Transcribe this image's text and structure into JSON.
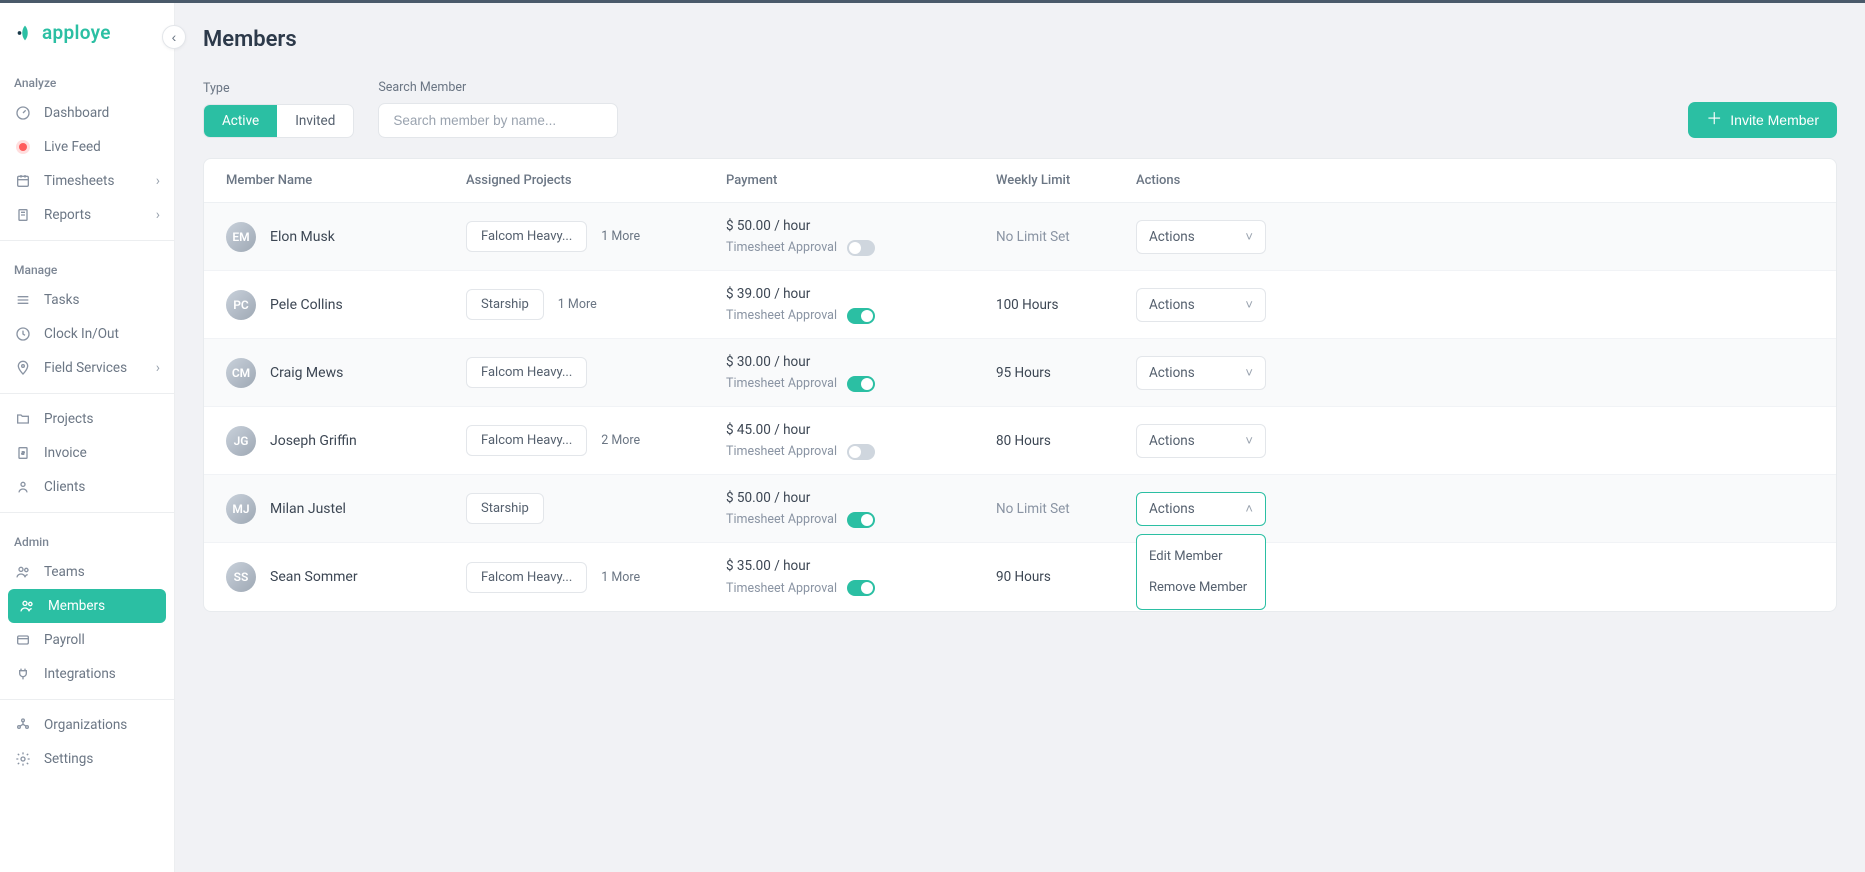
{
  "brand": {
    "name": "apploye"
  },
  "sidebar": {
    "sections": [
      {
        "title": "Analyze",
        "items": [
          {
            "id": "dashboard",
            "label": "Dashboard",
            "icon": "gauge-icon"
          },
          {
            "id": "live-feed",
            "label": "Live Feed",
            "icon": "live-dot-icon"
          },
          {
            "id": "timesheets",
            "label": "Timesheets",
            "icon": "calendar-icon",
            "chevron": true
          },
          {
            "id": "reports",
            "label": "Reports",
            "icon": "doc-icon",
            "chevron": true
          }
        ]
      },
      {
        "title": "Manage",
        "items": [
          {
            "id": "tasks",
            "label": "Tasks",
            "icon": "list-icon"
          },
          {
            "id": "clock",
            "label": "Clock In/Out",
            "icon": "clock-icon"
          },
          {
            "id": "field-services",
            "label": "Field Services",
            "icon": "pin-icon",
            "chevron": true
          },
          {
            "id": "projects",
            "label": "Projects",
            "icon": "folder-icon"
          },
          {
            "id": "invoice",
            "label": "Invoice",
            "icon": "dollar-file-icon"
          },
          {
            "id": "clients",
            "label": "Clients",
            "icon": "person-icon"
          }
        ]
      },
      {
        "title": "Admin",
        "items": [
          {
            "id": "teams",
            "label": "Teams",
            "icon": "people-icon"
          },
          {
            "id": "members",
            "label": "Members",
            "icon": "people-icon",
            "active": true
          },
          {
            "id": "payroll",
            "label": "Payroll",
            "icon": "card-icon"
          },
          {
            "id": "integrations",
            "label": "Integrations",
            "icon": "plug-icon"
          },
          {
            "id": "organizations",
            "label": "Organizations",
            "icon": "org-icon"
          },
          {
            "id": "settings",
            "label": "Settings",
            "icon": "gear-icon"
          }
        ]
      }
    ]
  },
  "page": {
    "title": "Members"
  },
  "filters": {
    "type_label": "Type",
    "search_label": "Search Member",
    "tabs": {
      "active": "Active",
      "invited": "Invited"
    },
    "search_placeholder": "Search member by name..."
  },
  "invite_button": "Invite Member",
  "table": {
    "headers": {
      "member": "Member Name",
      "projects": "Assigned Projects",
      "payment": "Payment",
      "limit": "Weekly Limit",
      "actions": "Actions"
    },
    "approval_label": "Timesheet Approval",
    "actions_label": "Actions",
    "dropdown": {
      "edit": "Edit Member",
      "remove": "Remove Member"
    },
    "rows": [
      {
        "name": "Elon Musk",
        "initials": "EM",
        "project": "Falcom Heavy...",
        "more": "1 More",
        "rate": "$ 50.00 / hour",
        "approval": false,
        "limit": "No Limit Set",
        "limit_muted": true
      },
      {
        "name": "Pele Collins",
        "initials": "PC",
        "project": "Starship",
        "more": "1 More",
        "rate": "$ 39.00 / hour",
        "approval": true,
        "limit": "100 Hours"
      },
      {
        "name": "Craig Mews",
        "initials": "CM",
        "project": "Falcom Heavy...",
        "more": "",
        "rate": "$ 30.00 / hour",
        "approval": true,
        "limit": "95 Hours"
      },
      {
        "name": "Joseph Griffin",
        "initials": "JG",
        "project": "Falcom Heavy...",
        "more": "2 More",
        "rate": "$ 45.00 / hour",
        "approval": false,
        "limit": "80 Hours"
      },
      {
        "name": "Milan Justel",
        "initials": "MJ",
        "project": "Starship",
        "more": "",
        "rate": "$ 50.00 / hour",
        "approval": true,
        "limit": "No Limit Set",
        "limit_muted": true,
        "dropdown_open": true
      },
      {
        "name": "Sean Sommer",
        "initials": "SS",
        "project": "Falcom Heavy...",
        "more": "1 More",
        "rate": "$ 35.00 / hour",
        "approval": true,
        "limit": "90 Hours"
      }
    ]
  }
}
